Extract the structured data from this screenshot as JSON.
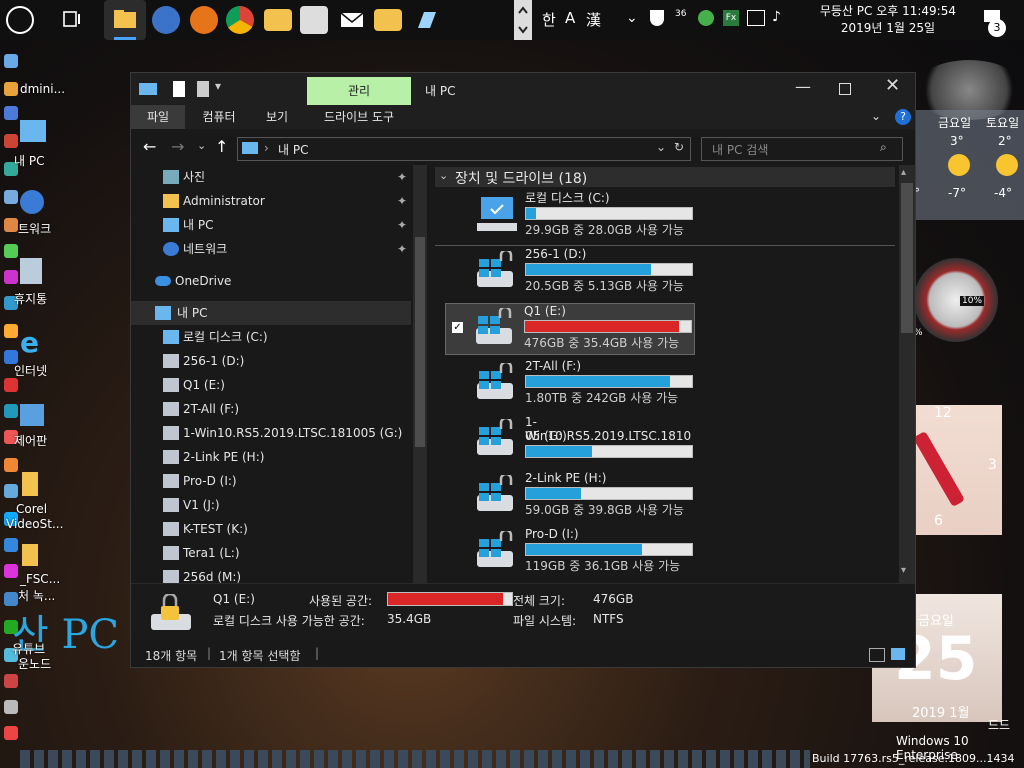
{
  "taskbar": {
    "ime_han": "한",
    "ime_a": "A",
    "ime_hanja": "漢",
    "tray_36": "36",
    "pc_time": "무등산 PC 오후 11:49:54",
    "date": "2019년 1월 25일",
    "notif_count": "3"
  },
  "desktop": {
    "labels": [
      "dmini...",
      "내 PC",
      "트워크",
      "휴지통",
      "인터넷",
      "제어판",
      "Corel",
      "VideoSt...",
      "_FSC...",
      "처 녹...",
      "유튜브",
      "운노드"
    ],
    "big_text": "산 PC",
    "weather": {
      "day1": "금요일",
      "day2": "토요일",
      "hi1": "3°",
      "hi2": "2°",
      "lo1": "-7°",
      "lo2": "-4°",
      "extra": "°"
    },
    "gauge_pct": "10%",
    "gauge_pct2": "%",
    "clock_12": "12",
    "clock_3": "3",
    "clock_6": "6",
    "cal_day_name": "금요일",
    "cal_day": "25",
    "cal_month": "2019 1월",
    "win_edition": "Windows 10 Enterprise",
    "build": "Build 17763.rs5_release.1809...1434",
    "ghost_text": "드드"
  },
  "window": {
    "title": "내 PC",
    "ctx_tab": "관리",
    "tabs": [
      "파일",
      "컴퓨터",
      "보기",
      "드라이브 도구"
    ],
    "address": "내 PC",
    "search_placeholder": "내 PC 검색",
    "nav": {
      "quick": [
        {
          "label": "사진"
        },
        {
          "label": "Administrator"
        },
        {
          "label": "내 PC"
        },
        {
          "label": "네트워크"
        }
      ],
      "onedrive": "OneDrive",
      "thispc": "내 PC",
      "drives": [
        "로컬 디스크 (C:)",
        "256-1 (D:)",
        "Q1 (E:)",
        "2T-All (F:)",
        "1-Win10.RS5.2019.LTSC.181005 (G:)",
        "2-Link PE (H:)",
        "Pro-D (I:)",
        "V1 (J:)",
        "K-TEST (K:)",
        "Tera1 (L:)",
        "256d (M:)"
      ]
    },
    "group_title": "장치 및 드라이브 (18)",
    "drives": [
      {
        "name": "로컬 디스크 (C:)",
        "info": "29.9GB 중 28.0GB 사용 가능",
        "used": 0.06
      },
      {
        "name": "256-1 (D:)",
        "info": "20.5GB 중 5.13GB 사용 가능",
        "used": 0.75
      },
      {
        "name": "Q1 (E:)",
        "info": "476GB 중 35.4GB 사용 가능",
        "used": 0.93
      },
      {
        "name": "2T-All (F:)",
        "info": "1.80TB 중 242GB 사용 가능",
        "used": 0.87
      },
      {
        "name1": "1-Win10.RS5.2019.LTSC.1810",
        "name2": "05 (G:)",
        "used": 0.4
      },
      {
        "name": "2-Link PE (H:)",
        "info": "59.0GB 중 39.8GB 사용 가능",
        "used": 0.33
      },
      {
        "name": "Pro-D (I:)",
        "info": "119GB 중 36.1GB 사용 가능",
        "used": 0.7
      }
    ],
    "details": {
      "name": "Q1 (E:)",
      "used_label": "사용된 공간:",
      "free_label": "로컬 디스크 사용 가능한 공간:",
      "free_value": "35.4GB",
      "total_label": "전체 크기:",
      "total_value": "476GB",
      "fs_label": "파일 시스템:",
      "fs_value": "NTFS",
      "used": 0.93
    },
    "status": {
      "items": "18개 항목",
      "selected": "1개 항목 선택함"
    }
  },
  "colors": {
    "accent": "#26a0da",
    "warn": "#da2626",
    "ctx_tab": "#b8f0a8"
  }
}
